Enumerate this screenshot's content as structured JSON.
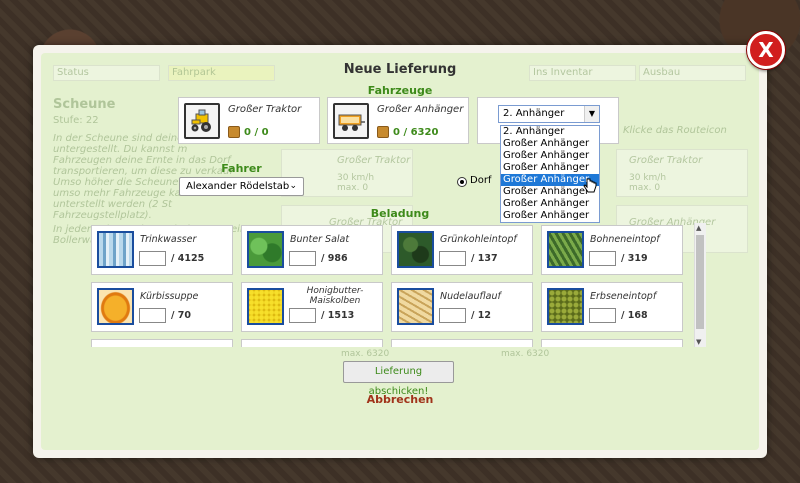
{
  "modal": {
    "title": "Neue Lieferung",
    "close_label": "X"
  },
  "background": {
    "status": "Status",
    "fahrpark": "Fahrpark",
    "ins_inventar": "Ins Inventar",
    "ausbau": "Ausbau",
    "scheune": "Scheune",
    "stufe": "Stufe: 22",
    "desc1": "In der Scheune sind deine",
    "desc2": "untergestellt. Du kannst m",
    "desc3": "Fahrzeugen deine Ernte in das Dorf",
    "desc4": "transportieren, um diese zu verkauf",
    "desc5": "Umso höher die Scheune aus",
    "desc6": "umso mehr Fahrzeuge kannst du",
    "desc7": "unterstellt werden (2 St",
    "desc8": "Fahrzeugstellplatz).",
    "desc9": "In jeder Scheune ist nach dem Bau ein",
    "desc10": "Bollerwagen.",
    "klicke": "Klicke das Routeicon",
    "bg_traktor": "Großer Traktor",
    "bg_speed": "30 km/h",
    "bg_max": "max. 0",
    "bg_anhaenger": "Großer Anhänger",
    "bg_max2": "max. 6320"
  },
  "fahrzeuge": {
    "heading": "Fahrzeuge",
    "vehicle1": {
      "name": "Großer Traktor",
      "stat": "0 / 0",
      "icon": "tractor-icon"
    },
    "vehicle2": {
      "name": "Großer Anhänger",
      "stat": "0 / 6320",
      "icon": "trailer-icon"
    },
    "trailer_select": {
      "value": "2. Anhänger"
    },
    "trailer_options": [
      "2. Anhänger",
      "Großer Anhänger",
      "Großer Anhänger",
      "Großer Anhänger",
      "Großer Anhänger",
      "Großer Anhänger",
      "Großer Anhänger",
      "Großer Anhänger"
    ],
    "highlighted_index": 4
  },
  "fahrer": {
    "heading": "Fahrer",
    "selected": "Alexander Rödelstab",
    "destination": "Dorf"
  },
  "beladung": {
    "heading": "Beladung",
    "items": [
      {
        "name": "Trinkwasser",
        "count": "4125",
        "color": "#7fb6d9"
      },
      {
        "name": "Bunter Salat",
        "count": "986",
        "color": "#3c8a3a"
      },
      {
        "name": "Grünkohleintopf",
        "count": "137",
        "color": "#2d5a2a"
      },
      {
        "name": "Bohneneintopf",
        "count": "319",
        "color": "#5b8a3a"
      },
      {
        "name": "Kürbissuppe",
        "count": "70",
        "color": "#e89a1e"
      },
      {
        "name": "Honigbutter-Maiskolben",
        "count": "1513",
        "color": "#f2d21e"
      },
      {
        "name": "Nudelauflauf",
        "count": "12",
        "color": "#e8c98a"
      },
      {
        "name": "Erbseneintopf",
        "count": "168",
        "color": "#7a8a2a"
      }
    ]
  },
  "actions": {
    "submit": "Lieferung abschicken!",
    "cancel": "Abbrechen"
  }
}
